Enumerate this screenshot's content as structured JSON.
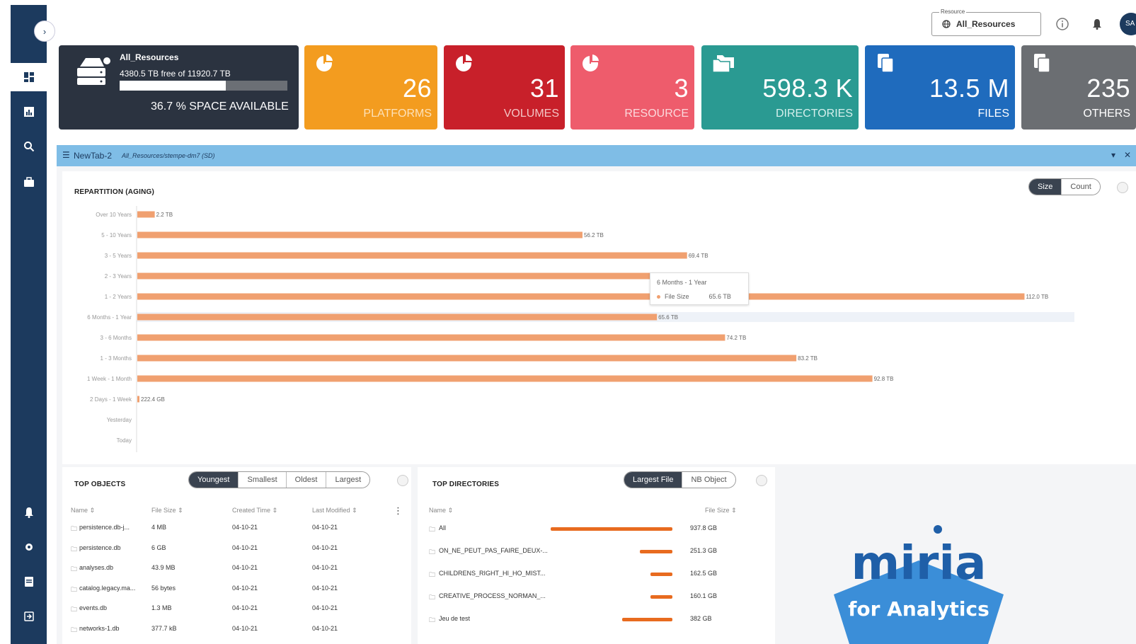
{
  "sidebar": {
    "toggle": "›",
    "items": [
      {
        "name": "dashboard",
        "icon": "dashboard-icon"
      },
      {
        "name": "reports",
        "icon": "chart-icon"
      },
      {
        "name": "search",
        "icon": "search-icon"
      },
      {
        "name": "jobs",
        "icon": "briefcase-icon"
      },
      {
        "name": "notifications",
        "icon": "bell-icon"
      },
      {
        "name": "settings",
        "icon": "gear-icon"
      },
      {
        "name": "docs",
        "icon": "document-icon"
      },
      {
        "name": "logout",
        "icon": "exit-icon"
      }
    ]
  },
  "header": {
    "resource_legend": "Resource",
    "resource_value": "All_Resources",
    "avatar": "SA"
  },
  "resource_card": {
    "name": "All_Resources",
    "free_text": "4380.5 TB free of 11920.7 TB",
    "space_fraction": 0.633,
    "pct_text": "36.7 % SPACE AVAILABLE"
  },
  "cards": [
    {
      "value": "26",
      "label": "PLATFORMS",
      "color": "#f39c1f"
    },
    {
      "value": "31",
      "label": "VOLUMES",
      "color": "#c8202a"
    },
    {
      "value": "3",
      "label": "RESOURCE",
      "color": "#ee5c6c"
    },
    {
      "value": "598.3 K",
      "label": "DIRECTORIES",
      "color": "#2a9a92"
    },
    {
      "value": "13.5 M",
      "label": "FILES",
      "color": "#1f6bbd"
    },
    {
      "value": "235",
      "label": "OTHERS",
      "color": "#6b6e72"
    }
  ],
  "tab": {
    "hamburger": "☰",
    "name": "NewTab-2",
    "path": "All_Resources/stempe-dm7 (SD)",
    "collapse": "▾",
    "close": "✕"
  },
  "aging": {
    "title": "REPARTITION (AGING)",
    "toggle": [
      "Size",
      "Count"
    ],
    "tooltip_title": "6 Months - 1 Year",
    "tooltip_series": "File Size",
    "tooltip_value": "65.6 TB"
  },
  "chart_data": {
    "type": "bar",
    "orientation": "horizontal",
    "title": "REPARTITION (AGING)",
    "categories": [
      "Over 10 Years",
      "5 - 10 Years",
      "3 - 5 Years",
      "2 - 3 Years",
      "1 - 2 Years",
      "6 Months - 1 Year",
      "3 - 6 Months",
      "1 - 3 Months",
      "1 Week - 1 Month",
      "2 Days - 1 Week",
      "Yesterday",
      "Today"
    ],
    "values_tb": [
      2.2,
      56.2,
      69.4,
      65.6,
      112.0,
      65.6,
      74.2,
      83.2,
      92.8,
      0.2224,
      0,
      0
    ],
    "labels": [
      "2.2 TB",
      "56.2 TB",
      "69.4 TB",
      "",
      "112.0 TB",
      "65.6 TB",
      "74.2 TB",
      "83.2 TB",
      "92.8 TB",
      "222.4 GB",
      "",
      ""
    ],
    "xlim": [
      0,
      120
    ],
    "bar_color": "#f0a070",
    "highlight": "6 Months - 1 Year"
  },
  "top_objects": {
    "title": "TOP OBJECTS",
    "toggle": [
      "Youngest",
      "Smallest",
      "Oldest",
      "Largest"
    ],
    "columns": [
      "Name ⇕",
      "File Size ⇕",
      "Created Time ⇕",
      "Last Modified ⇕"
    ],
    "rows": [
      [
        "persistence.db-j...",
        "4 MB",
        "04-10-21",
        "04-10-21"
      ],
      [
        "persistence.db",
        "6 GB",
        "04-10-21",
        "04-10-21"
      ],
      [
        "analyses.db",
        "43.9 MB",
        "04-10-21",
        "04-10-21"
      ],
      [
        "catalog.legacy.ma...",
        "56 bytes",
        "04-10-21",
        "04-10-21"
      ],
      [
        "events.db",
        "1.3 MB",
        "04-10-21",
        "04-10-21"
      ],
      [
        "networks-1.db",
        "377.7 kB",
        "04-10-21",
        "04-10-21"
      ]
    ],
    "more": "⋮"
  },
  "top_dirs": {
    "title": "TOP DIRECTORIES",
    "toggle": [
      "Largest File",
      "NB Object"
    ],
    "columns": [
      "Name ⇕",
      "File Size ⇕"
    ],
    "rows": [
      {
        "name": "All",
        "size": "937.8 GB",
        "fraction": 1.0
      },
      {
        "name": "ON_NE_PEUT_PAS_FAIRE_DEUX-...",
        "size": "251.3 GB",
        "fraction": 0.27
      },
      {
        "name": "CHILDRENS_RIGHT_HI_HO_MIST...",
        "size": "162.5 GB",
        "fraction": 0.18
      },
      {
        "name": "CREATIVE_PROCESS_NORMAN_...",
        "size": "160.1 GB",
        "fraction": 0.18
      },
      {
        "name": "Jeu de test",
        "size": "382 GB",
        "fraction": 0.41
      }
    ]
  },
  "logo": {
    "brand": "miria",
    "tagline": "for Analytics"
  }
}
